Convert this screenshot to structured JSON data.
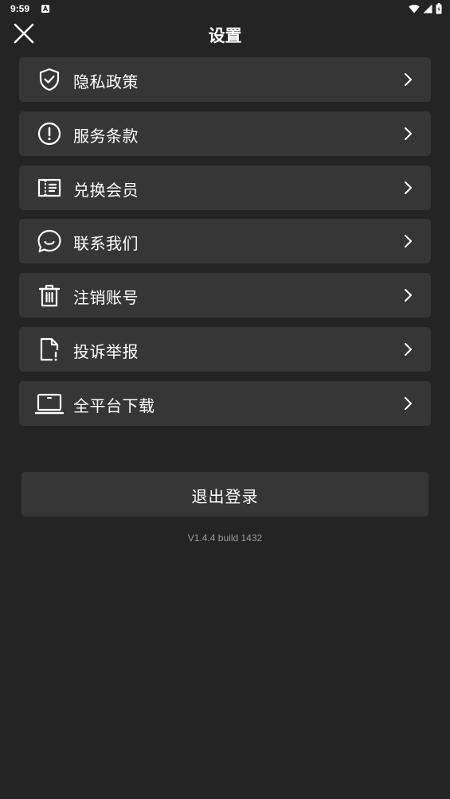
{
  "statusbar": {
    "time": "9:59",
    "icons": [
      "a-notification-icon",
      "wifi-icon",
      "signal-icon",
      "battery-icon"
    ]
  },
  "header": {
    "title": "设置",
    "close_icon": "close-icon"
  },
  "menu": {
    "items": [
      {
        "label": "隐私政策",
        "icon": "shield-check-icon"
      },
      {
        "label": "服务条款",
        "icon": "alert-circle-icon"
      },
      {
        "label": "兑换会员",
        "icon": "ticket-icon"
      },
      {
        "label": "联系我们",
        "icon": "chat-bubble-icon"
      },
      {
        "label": "注销账号",
        "icon": "trash-icon"
      },
      {
        "label": "投诉举报",
        "icon": "report-file-icon"
      },
      {
        "label": "全平台下载",
        "icon": "laptop-icon"
      }
    ],
    "chevron_icon": "chevron-right-icon"
  },
  "logout": {
    "label": "退出登录"
  },
  "version": "V1.4.4 build 1432",
  "colors": {
    "background": "#242424",
    "card": "#363636",
    "text": "#ffffff",
    "muted": "#9a9a9a"
  }
}
